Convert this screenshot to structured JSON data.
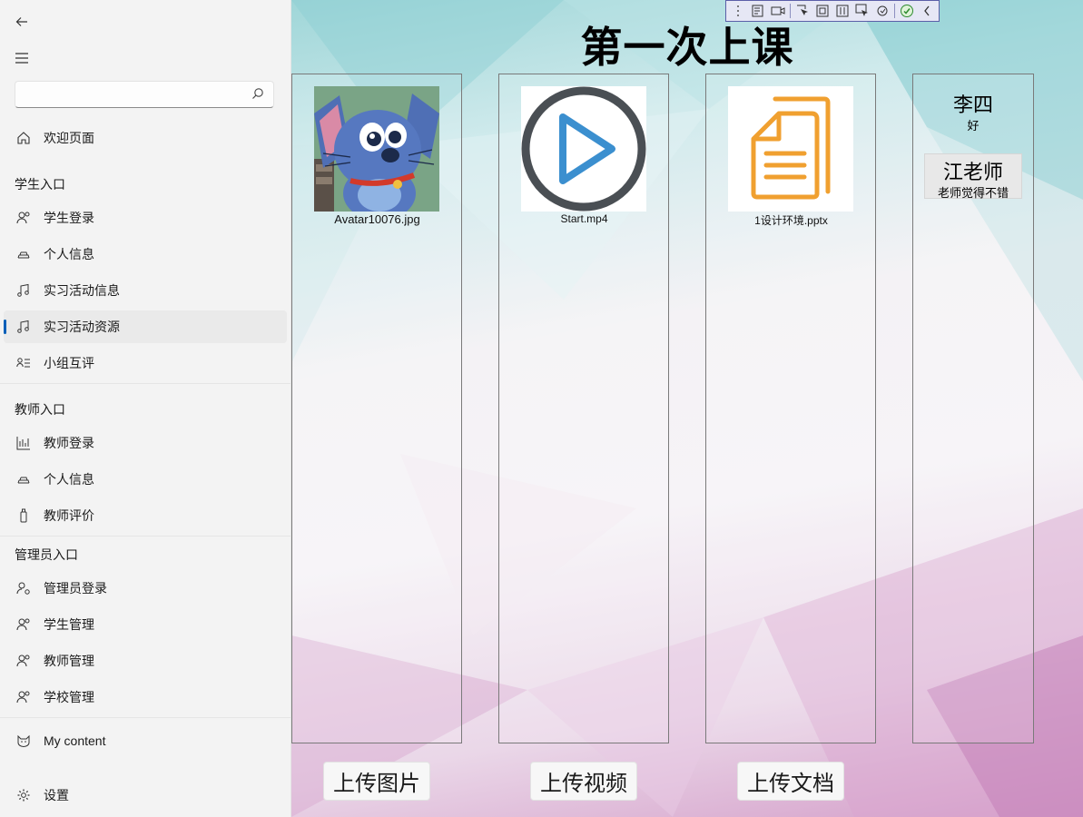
{
  "sidebar": {
    "back_icon": "back-arrow-icon",
    "menu_icon": "hamburger-icon",
    "search": {
      "value": "",
      "placeholder": "",
      "icon": "search-icon"
    },
    "welcome": "欢迎页面",
    "student_section": "学生入口",
    "student_items": [
      "学生登录",
      "个人信息",
      "实习活动信息",
      "实习活动资源",
      "小组互评"
    ],
    "teacher_section": "教师入口",
    "teacher_items": [
      "教师登录",
      "个人信息",
      "教师评价"
    ],
    "admin_section": "管理员入口",
    "admin_items": [
      "管理员登录",
      "学生管理",
      "教师管理",
      "学校管理"
    ],
    "my_content": "My content",
    "settings": "设置",
    "selected_index": 3,
    "accent": "#005fb8"
  },
  "main": {
    "title": "第一次上课",
    "files": [
      {
        "name": "Avatar10076.jpg",
        "type": "image"
      },
      {
        "name": "Start.mp4",
        "type": "video"
      },
      {
        "name": "1设计环境.pptx",
        "type": "document"
      }
    ],
    "comments": {
      "student_name": "李四",
      "student_comment": "好",
      "teacher_name": "江老师",
      "teacher_comment": "老师觉得不错"
    },
    "buttons": {
      "upload_image": "上传图片",
      "upload_video": "上传视频",
      "upload_document": "上传文档"
    }
  },
  "colors": {
    "play_blue": "#3b8fcf",
    "play_ring": "#4a4f54",
    "doc_orange": "#f0a030"
  }
}
